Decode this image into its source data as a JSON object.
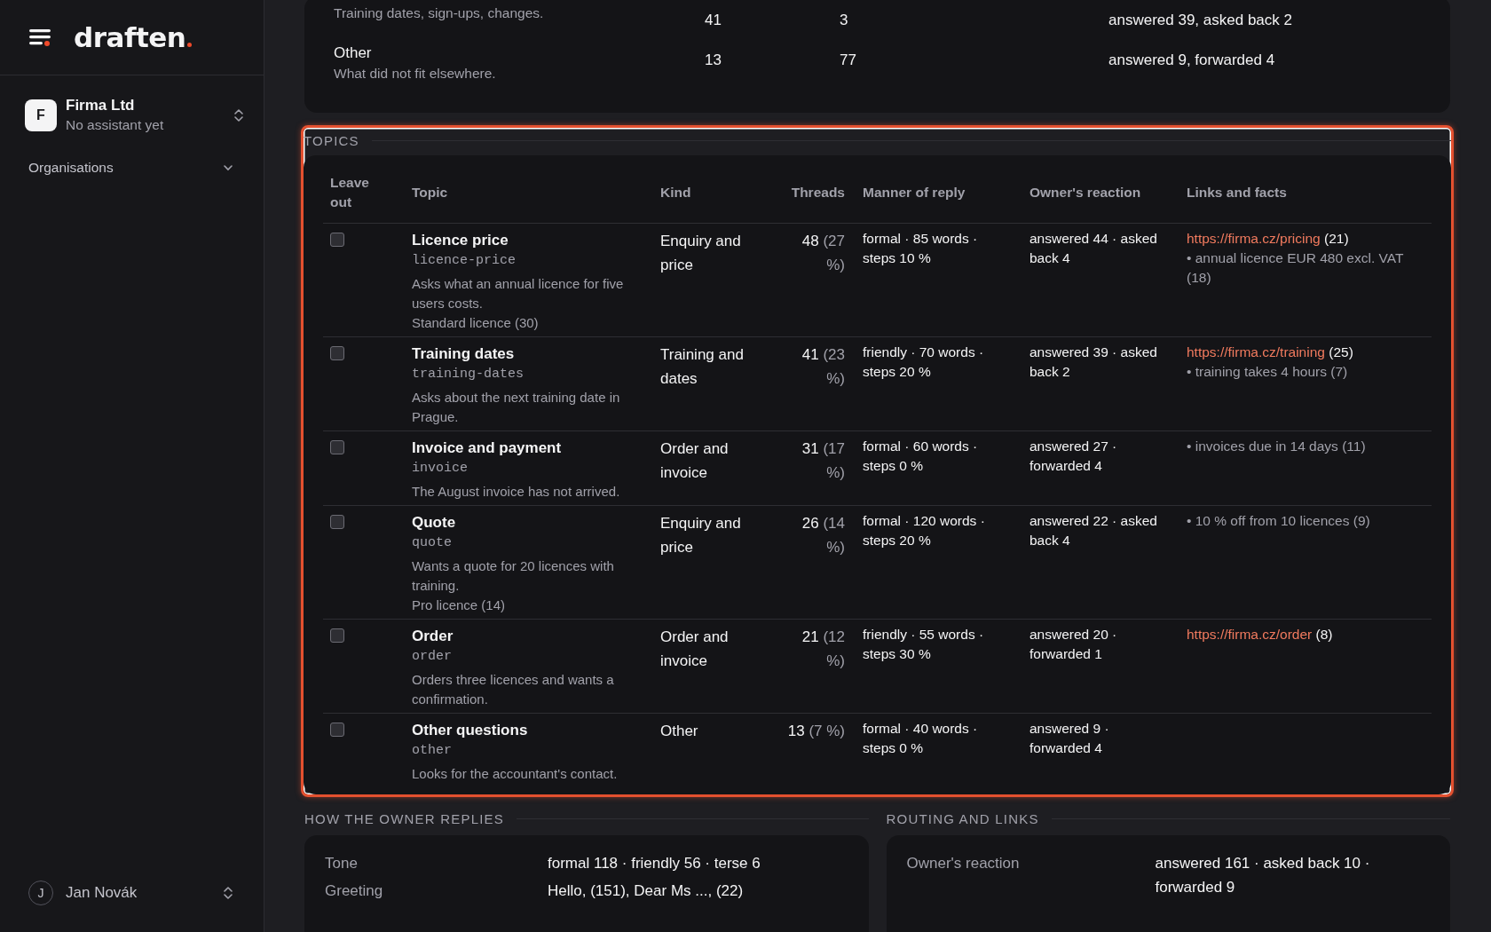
{
  "sidebar": {
    "logo": "draften",
    "org": {
      "initial": "F",
      "name": "Firma Ltd",
      "subtitle": "No assistant yet"
    },
    "nav": [
      {
        "label": "Organisations",
        "expanded": false
      }
    ],
    "user": {
      "initial": "J",
      "name": "Jan Novák"
    }
  },
  "categories": {
    "rows": [
      {
        "description": "Training dates, sign-ups, changes.",
        "column_2": "41",
        "column_3": "3",
        "column_4": "answered 39, asked back 2"
      },
      {
        "title": "Other",
        "description": "What did not fit elsewhere.",
        "column_2": "13",
        "column_3": "77",
        "column_4": "answered 9, forwarded 4"
      }
    ]
  },
  "topics": {
    "heading": "TOPICS",
    "selected": true,
    "columns": [
      "Leave out",
      "Topic",
      "Kind",
      "Threads",
      "Manner of reply",
      "Owner's reaction",
      "Links and facts"
    ],
    "rows": [
      {
        "leave_out": false,
        "title": "Licence price",
        "slug": "licence-price",
        "description": "Asks what an annual licence for five users costs.",
        "note": "Standard licence (30)",
        "kind": "Enquiry and price",
        "threads": "48",
        "share": "(27 %)",
        "manner": "formal · 85 words · steps 10 %",
        "reaction": "answered 44 · asked back 4",
        "links": [
          {
            "url": "https://firma.cz/pricing",
            "count": "(21)"
          }
        ],
        "facts": [
          "• annual licence EUR 480 excl. VAT (18)"
        ]
      },
      {
        "leave_out": false,
        "title": "Training dates",
        "slug": "training-dates",
        "description": "Asks about the next training date in Prague.",
        "kind": "Training and dates",
        "threads": "41",
        "share": "(23 %)",
        "manner": "friendly · 70 words · steps 20 %",
        "reaction": "answered 39 · asked back 2",
        "links": [
          {
            "url": "https://firma.cz/training",
            "count": "(25)"
          }
        ],
        "facts": [
          "• training takes 4 hours (7)"
        ]
      },
      {
        "leave_out": false,
        "title": "Invoice and payment",
        "slug": "invoice",
        "description": "The August invoice has not arrived.",
        "kind": "Order and invoice",
        "threads": "31",
        "share": "(17 %)",
        "manner": "formal · 60 words · steps 0 %",
        "reaction": "answered 27 · forwarded 4",
        "facts": [
          "• invoices due in 14 days (11)"
        ]
      },
      {
        "leave_out": false,
        "title": "Quote",
        "slug": "quote",
        "description": "Wants a quote for 20 licences with training.",
        "note": "Pro licence (14)",
        "kind": "Enquiry and price",
        "threads": "26",
        "share": "(14 %)",
        "manner": "formal · 120 words · steps 20 %",
        "reaction": "answered 22 · asked back 4",
        "facts": [
          "• 10 % off from 10 licences (9)"
        ]
      },
      {
        "leave_out": false,
        "title": "Order",
        "slug": "order",
        "description": "Orders three licences and wants a confirmation.",
        "kind": "Order and invoice",
        "threads": "21",
        "share": "(12 %)",
        "manner": "friendly · 55 words · steps 30 %",
        "reaction": "answered 20 · forwarded 1",
        "links": [
          {
            "url": "https://firma.cz/order",
            "count": "(8)"
          }
        ]
      },
      {
        "leave_out": false,
        "title": "Other questions",
        "slug": "other",
        "description": "Looks for the accountant's contact.",
        "kind": "Other",
        "threads": "13",
        "share": "(7 %)",
        "manner": "formal · 40 words · steps 0 %",
        "reaction": "answered 9 · forwarded 4"
      }
    ]
  },
  "sections": [
    {
      "heading": "HOW THE OWNER REPLIES",
      "rows": [
        {
          "label": "Tone",
          "value": "formal 118 · friendly 56 · terse 6"
        },
        {
          "label": "Greeting",
          "value": "Hello, (151), Dear Ms ..., (22)"
        }
      ]
    },
    {
      "heading": "ROUTING AND LINKS",
      "rows": [
        {
          "label": "Owner's reaction",
          "value": "answered 161 · asked back 10 · forwarded 9"
        }
      ]
    }
  ]
}
